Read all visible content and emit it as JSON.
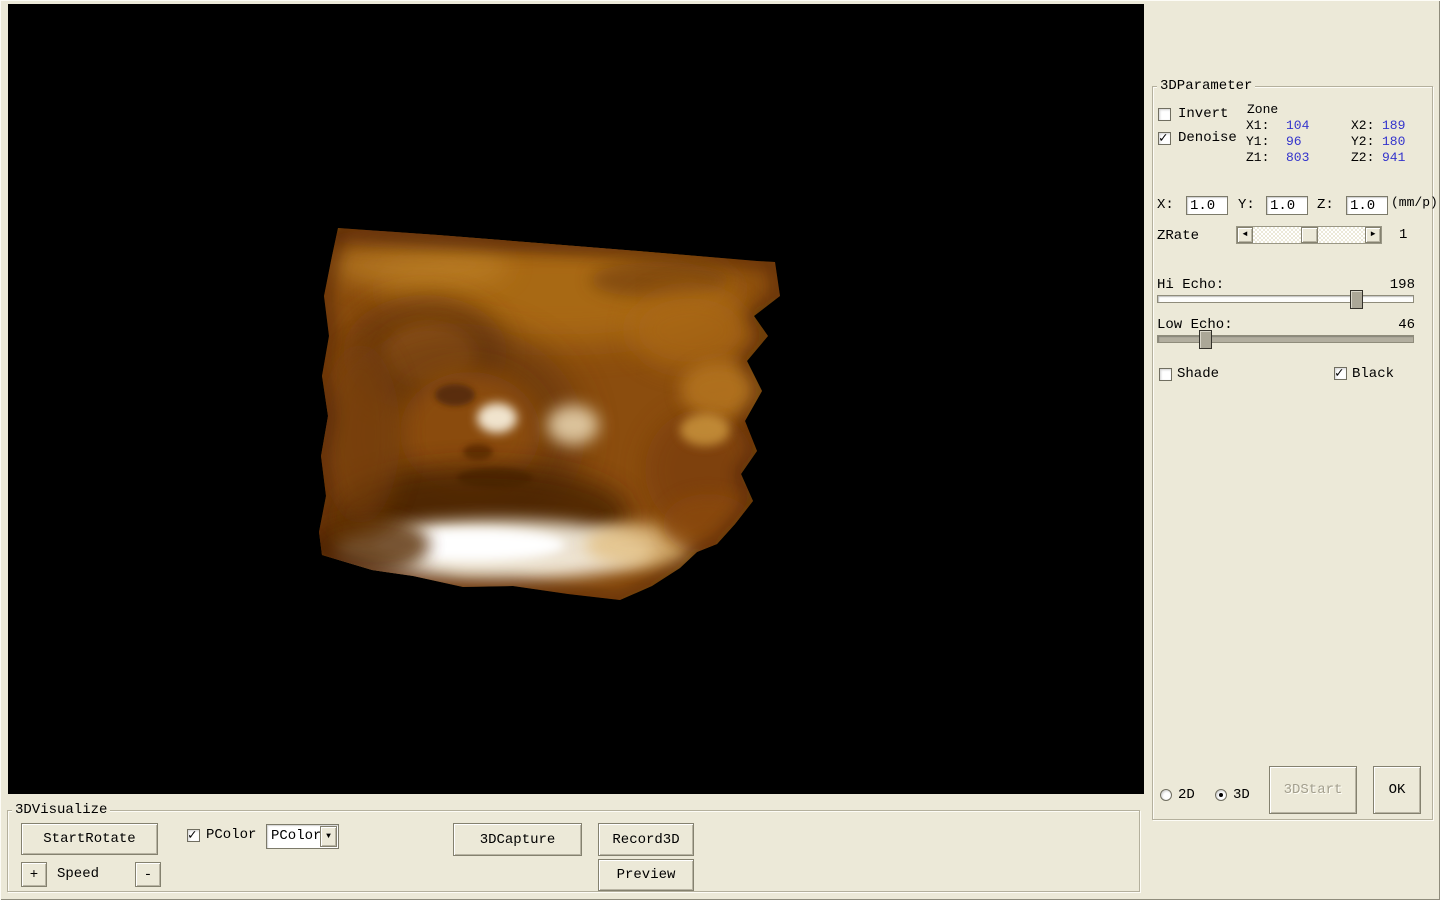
{
  "app": {
    "background_color": "#ece9d8",
    "value_text_color": "#3333cc"
  },
  "viewport": {
    "description": "3D ultrasound volume rendering (fetal face), amber colormap on black"
  },
  "param_panel": {
    "group_title": "3DParameter",
    "invert": {
      "label": "Invert",
      "checked": false
    },
    "denoise": {
      "label": "Denoise",
      "checked": true
    },
    "zone": {
      "title": "Zone",
      "rows": [
        {
          "l1": "X1:",
          "v1": "104",
          "l2": "X2:",
          "v2": "189"
        },
        {
          "l1": "Y1:",
          "v1": "96",
          "l2": "Y2:",
          "v2": "180"
        },
        {
          "l1": "Z1:",
          "v1": "803",
          "l2": "Z2:",
          "v2": "941"
        }
      ]
    },
    "scale": {
      "x_label": "X:",
      "x_value": "1.0",
      "y_label": "Y:",
      "y_value": "1.0",
      "z_label": "Z:",
      "z_value": "1.0",
      "unit": "(mm/p)"
    },
    "zrate": {
      "label": "ZRate",
      "value": "1"
    },
    "hi_echo": {
      "label": "Hi Echo:",
      "value": "198"
    },
    "low_echo": {
      "label": "Low Echo:",
      "value": "46"
    },
    "shade": {
      "label": "Shade",
      "checked": false
    },
    "black": {
      "label": "Black",
      "checked": true
    },
    "mode_2d": {
      "label": "2D",
      "selected": false
    },
    "mode_3d": {
      "label": "3D",
      "selected": true
    },
    "start3d_button": {
      "label": "3DStart",
      "disabled": true
    },
    "ok_button": {
      "label": "OK",
      "disabled": false
    }
  },
  "visualize_panel": {
    "group_title": "3DVisualize",
    "start_rotate_button": "StartRotate",
    "speed": {
      "plus": "+",
      "label": "Speed",
      "minus": "-"
    },
    "pcolor_checkbox": {
      "label": "PColor",
      "checked": true
    },
    "pcolor_dropdown": {
      "value": "PColor"
    },
    "capture_button": "3DCapture",
    "record_button": "Record3D",
    "preview_button": "Preview"
  }
}
